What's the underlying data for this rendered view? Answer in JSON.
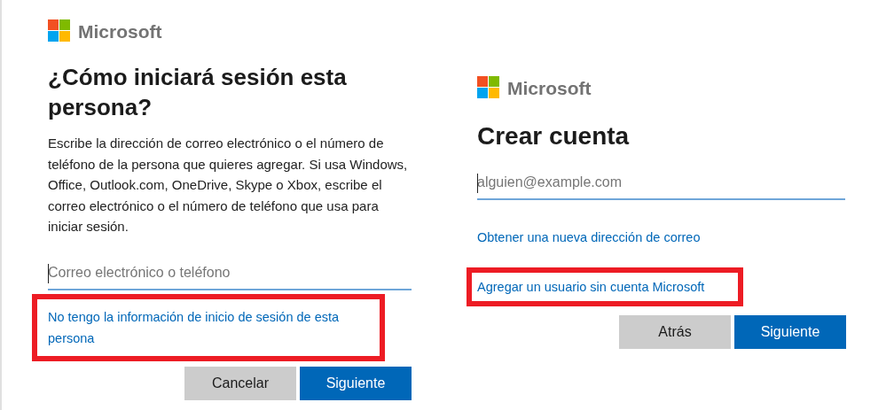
{
  "panels": [
    {
      "brand": "Microsoft",
      "title": "¿Cómo iniciará sesión esta persona?",
      "description": "Escribe la dirección de correo electrónico o el número de teléfono de la persona que quieres agregar. Si usa Windows, Office, Outlook.com, OneDrive, Skype o Xbox, escribe el correo electrónico o el número de teléfono que usa para iniciar sesión.",
      "input": {
        "placeholder": "Correo electrónico o teléfono"
      },
      "links": [
        {
          "label": "No tengo la información de inicio de sesión de esta persona",
          "highlighted": true
        }
      ],
      "buttons": [
        {
          "label": "Cancelar",
          "kind": "secondary"
        },
        {
          "label": "Siguiente",
          "kind": "primary"
        }
      ]
    },
    {
      "brand": "Microsoft",
      "title": "Crear cuenta",
      "input": {
        "placeholder": "alguien@example.com"
      },
      "links": [
        {
          "label": "Obtener una nueva dirección de correo",
          "highlighted": false
        },
        {
          "label": "Agregar un usuario sin cuenta Microsoft",
          "highlighted": true
        }
      ],
      "buttons": [
        {
          "label": "Atrás",
          "kind": "secondary"
        },
        {
          "label": "Siguiente",
          "kind": "primary"
        }
      ]
    }
  ]
}
